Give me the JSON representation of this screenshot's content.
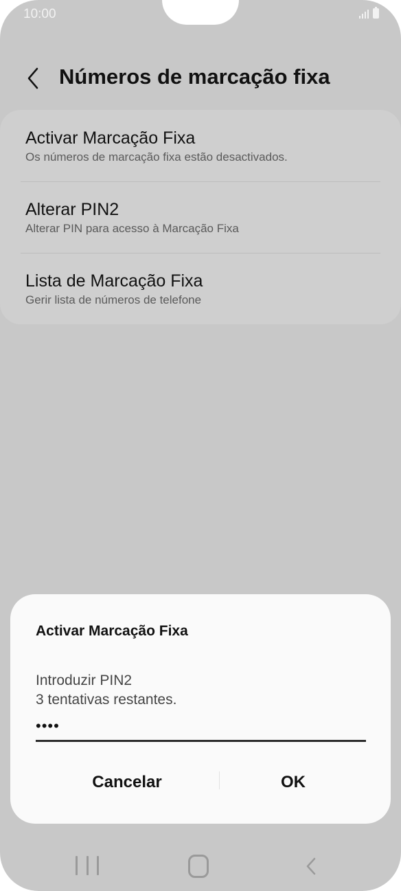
{
  "status_bar": {
    "time": "10:00",
    "icons": [
      "signal-icon",
      "battery-icon"
    ]
  },
  "header": {
    "back_icon": "chevron-left-icon",
    "title": "Números de marcação fixa"
  },
  "settings": {
    "items": [
      {
        "title": "Activar Marcação Fixa",
        "subtitle": "Os números de marcação fixa estão desactivados."
      },
      {
        "title": "Alterar PIN2",
        "subtitle": "Alterar PIN para acesso à Marcação Fixa"
      },
      {
        "title": "Lista de Marcação Fixa",
        "subtitle": "Gerir lista de números de telefone"
      }
    ]
  },
  "dialog": {
    "title": "Activar Marcação Fixa",
    "message_line1": "Introduzir PIN2",
    "message_line2": "3 tentativas restantes.",
    "pin_value": "••••",
    "cancel_label": "Cancelar",
    "ok_label": "OK"
  },
  "nav_bar": {
    "icons": [
      "recents-icon",
      "home-icon",
      "back-icon"
    ]
  },
  "colors": {
    "dim_background": "#c8c8c8",
    "dialog_background": "#fafafa",
    "text_primary": "#111111"
  }
}
